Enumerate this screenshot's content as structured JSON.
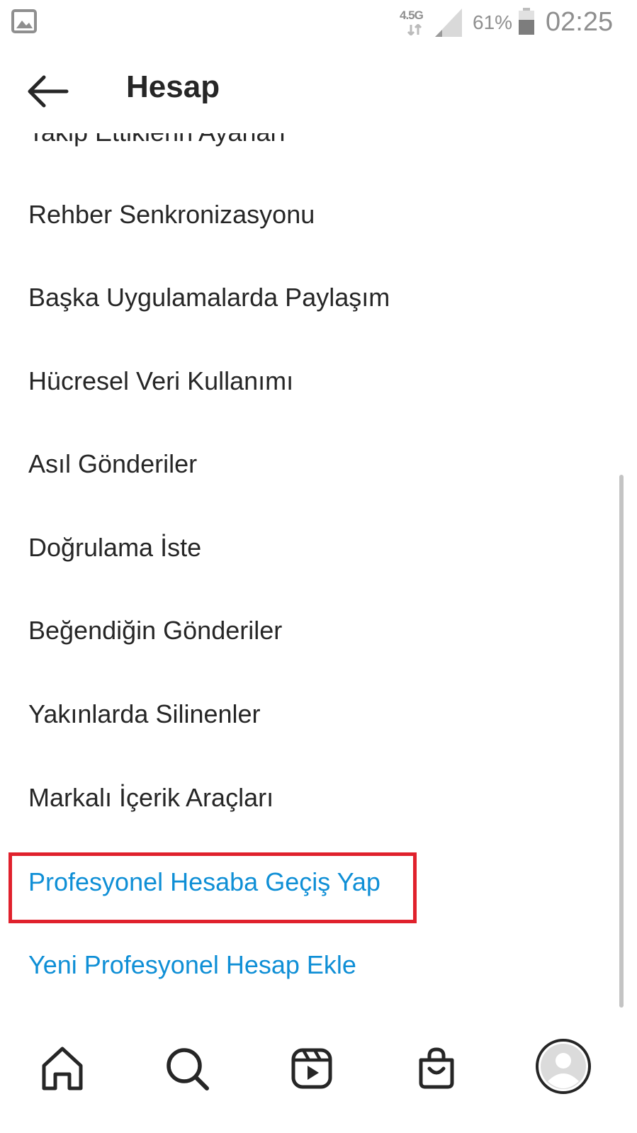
{
  "status_bar": {
    "network": "4.5G",
    "battery_percent": "61%",
    "time": "02:25",
    "icons": [
      "gallery-icon",
      "network-arrows-icon",
      "signal-icon",
      "battery-icon"
    ]
  },
  "header": {
    "title": "Hesap",
    "back_icon": "back-arrow-icon"
  },
  "menu": {
    "partial_item": "Takip Ettiklerin Ayarları",
    "items": [
      "Rehber Senkronizasyonu",
      "Başka Uygulamalarda Paylaşım",
      "Hücresel Veri Kullanımı",
      "Asıl Gönderiler",
      "Doğrulama İste",
      "Beğendiğin Gönderiler",
      "Yakınlarda Silinenler",
      "Markalı İçerik Araçları"
    ],
    "actions": [
      "Profesyonel Hesaba Geçiş Yap",
      "Yeni Profesyonel Hesap Ekle"
    ]
  },
  "bottom_nav": {
    "items": [
      "home-icon",
      "search-icon",
      "reels-icon",
      "shop-icon",
      "profile-avatar"
    ]
  },
  "colors": {
    "text": "#262626",
    "link": "#0f8fd6",
    "highlight": "#e0212c",
    "status": "#8f8f8f"
  }
}
